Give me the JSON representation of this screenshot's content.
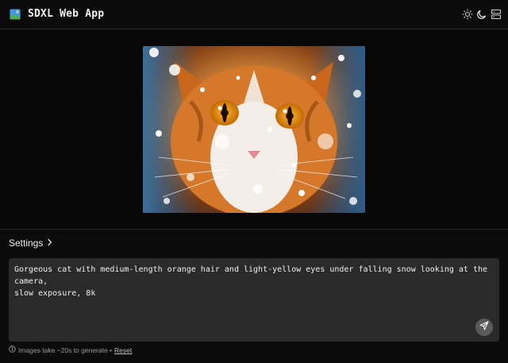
{
  "header": {
    "title": "SDXL Web App",
    "icons": [
      "image-logo-icon",
      "sun-icon",
      "moon-icon",
      "server-icon"
    ]
  },
  "image": {
    "subject": "orange and white cat portrait with snow"
  },
  "settings": {
    "label": "Settings"
  },
  "prompt": {
    "value": "Gorgeous cat with medium-length orange hair and light-yellow eyes under falling snow looking at the camera,\nslow exposure, 8k"
  },
  "footer": {
    "note": "Images take ~20s to generate •",
    "reset_label": "Reset"
  },
  "colors": {
    "background": "#0b0b0b",
    "prompt_bg": "#2a2a2a",
    "send_button": "#5a5a5a"
  }
}
